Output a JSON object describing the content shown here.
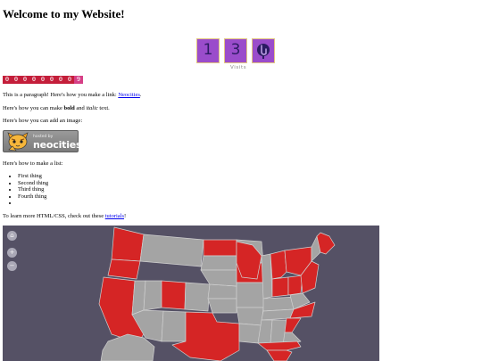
{
  "page": {
    "title": "Welcome to my Website!"
  },
  "counter": {
    "digits": [
      "1",
      "3"
    ],
    "label": "Visits",
    "colors": {
      "cell": "#9a4ccb",
      "border": "#e2c680",
      "digit": "#2c1b63"
    }
  },
  "hit_counter": {
    "digits": [
      "0",
      "0",
      "0",
      "0",
      "0",
      "0",
      "0",
      "0",
      "9"
    ],
    "colors": {
      "background": "#c41e3a",
      "last": "#d63f86"
    }
  },
  "content": {
    "para_link_prefix": "This is a paragraph! Here's how you make a link: ",
    "para_link_text": "Neocities",
    "para_link_suffix": ".",
    "bold_prefix": "Here's how you can make ",
    "bold_text": "bold",
    "bold_middle": " and ",
    "italic_text": "italic",
    "bold_suffix": " text.",
    "image_text": "Here's how you can add an image:",
    "list_intro": "Here's how to make a list:",
    "list_items": [
      "First thing",
      "Second thing",
      "Third thing",
      "Fourth thing",
      ""
    ],
    "learn_prefix": "To learn more HTML/CSS, check out these ",
    "learn_link": "tutorials",
    "learn_suffix": "!"
  },
  "badge": {
    "small_text": "hosted by",
    "big_text": "neocities"
  },
  "map": {
    "colors": {
      "background": "#555165",
      "highlighted": "#d52525",
      "default": "#a4a4a4",
      "border": "#d0d0d0"
    },
    "controls": [
      {
        "name": "home-icon",
        "glyph": "⌂"
      },
      {
        "name": "zoom-in-icon",
        "glyph": "+"
      },
      {
        "name": "zoom-out-icon",
        "glyph": "−"
      }
    ]
  }
}
